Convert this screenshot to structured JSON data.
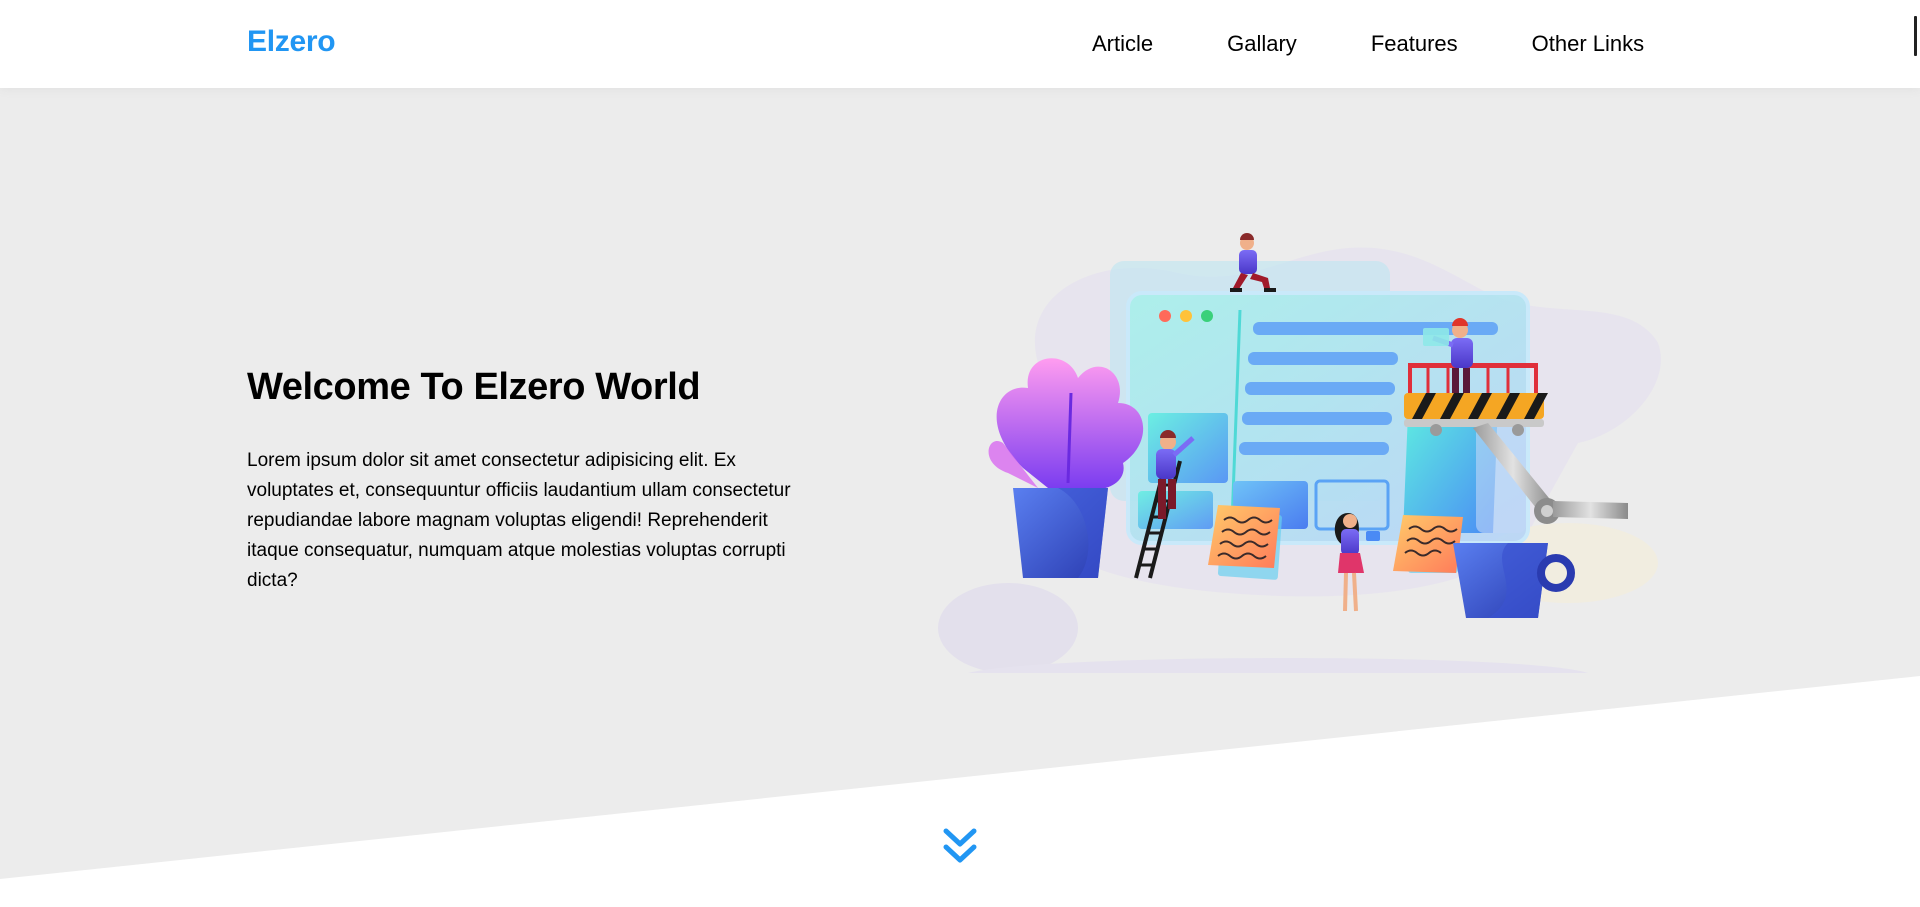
{
  "header": {
    "logo": "Elzero",
    "nav": [
      {
        "label": "Article"
      },
      {
        "label": "Gallary"
      },
      {
        "label": "Features"
      },
      {
        "label": "Other Links"
      }
    ]
  },
  "landing": {
    "title": "Welcome To Elzero World",
    "text": "Lorem ipsum dolor sit amet consectetur adipisicing elit. Ex voluptates et, consequuntur officiis laudantium ullam consectetur repudiandae labore magnam voluptas eligendi! Reprehenderit itaque consequatur, numquam atque molestias voluptas corrupti dicta?",
    "illustration": "landing-illustration",
    "go_down_icon": "double-chevron-down-icon"
  },
  "colors": {
    "brand": "#2196f3",
    "landing_bg": "#ececec",
    "background": "#ffffff",
    "text": "#000000"
  }
}
